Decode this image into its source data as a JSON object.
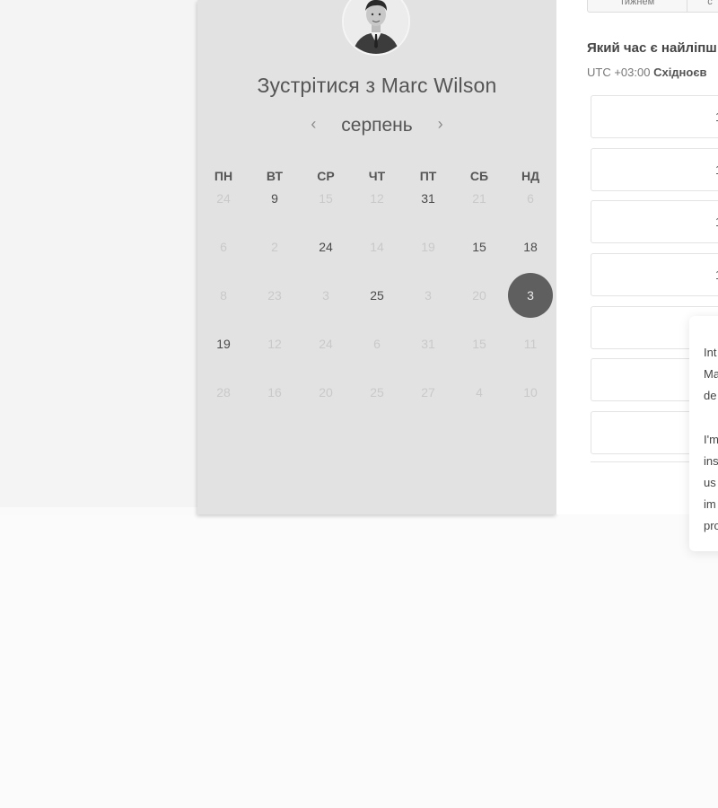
{
  "scheduler": {
    "title": "Зустрітися з Marc Wilson",
    "month": "серпень",
    "prev_icon": "‹",
    "next_icon": "›",
    "weekdays": [
      "ПН",
      "ВТ",
      "СР",
      "ЧТ",
      "ПТ",
      "СБ",
      "НД"
    ],
    "weeks": [
      [
        {
          "d": "24",
          "a": false
        },
        {
          "d": "9",
          "a": true
        },
        {
          "d": "15",
          "a": false
        },
        {
          "d": "12",
          "a": false
        },
        {
          "d": "31",
          "a": true
        },
        {
          "d": "21",
          "a": false
        },
        {
          "d": "6",
          "a": false
        }
      ],
      [
        {
          "d": "6",
          "a": false
        },
        {
          "d": "2",
          "a": false
        },
        {
          "d": "24",
          "a": true
        },
        {
          "d": "14",
          "a": false
        },
        {
          "d": "19",
          "a": false
        },
        {
          "d": "15",
          "a": true
        },
        {
          "d": "18",
          "a": true
        }
      ],
      [
        {
          "d": "8",
          "a": false
        },
        {
          "d": "23",
          "a": false
        },
        {
          "d": "3",
          "a": false
        },
        {
          "d": "25",
          "a": true
        },
        {
          "d": "3",
          "a": false
        },
        {
          "d": "20",
          "a": false
        },
        {
          "d": "3",
          "a": true,
          "selected": true
        }
      ],
      [
        {
          "d": "19",
          "a": true
        },
        {
          "d": "12",
          "a": false
        },
        {
          "d": "24",
          "a": false
        },
        {
          "d": "6",
          "a": false
        },
        {
          "d": "31",
          "a": false
        },
        {
          "d": "15",
          "a": false
        },
        {
          "d": "11",
          "a": false
        }
      ],
      [
        {
          "d": "28",
          "a": false
        },
        {
          "d": "16",
          "a": false
        },
        {
          "d": "20",
          "a": false
        },
        {
          "d": "25",
          "a": false
        },
        {
          "d": "27",
          "a": false
        },
        {
          "d": "4",
          "a": false
        },
        {
          "d": "10",
          "a": false
        }
      ]
    ]
  },
  "right": {
    "tabs": [
      "тижнем",
      "с"
    ],
    "question": "Який час є найліпш",
    "tz_offset": "UTC +03:00",
    "tz_name": "Східноєв",
    "slots": [
      "1",
      "1",
      "1",
      "1",
      "",
      "",
      ""
    ]
  },
  "popover": {
    "lines": [
      "Int",
      "Ma",
      "de",
      "",
      "I'm",
      "ins",
      "us",
      "im",
      "pro"
    ]
  },
  "colors": {
    "panel_bg": "#e2e2e2",
    "selected_day": "#5f5f5f"
  }
}
